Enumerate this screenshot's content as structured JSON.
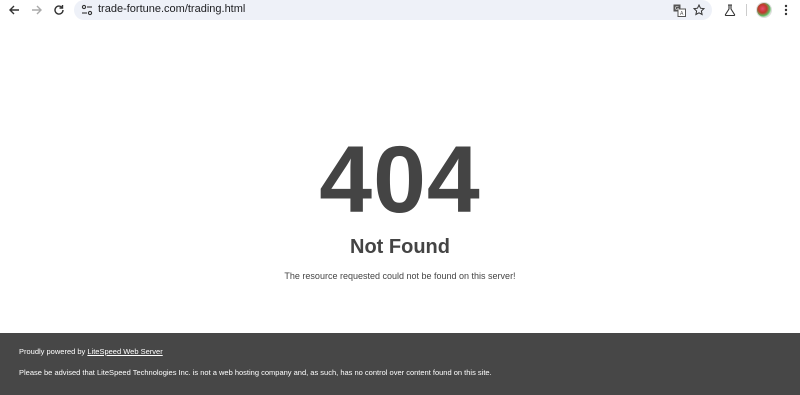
{
  "browser": {
    "url": "trade-fortune.com/trading.html",
    "icons": {
      "back": "arrow-left-icon",
      "forward": "arrow-right-icon",
      "reload": "reload-icon",
      "site_info": "site-info-icon",
      "translate": "translate-icon",
      "bookmark": "star-icon",
      "labs": "flask-icon",
      "menu": "kebab-menu-icon"
    }
  },
  "page": {
    "code": "404",
    "title": "Not Found",
    "message": "The resource requested could not be found on this server!"
  },
  "footer": {
    "powered_prefix": "Proudly powered by ",
    "powered_link": "LiteSpeed Web Server",
    "disclaimer": "Please be advised that LiteSpeed Technologies Inc. is not a web hosting company and, as such, has no control over content found on this site."
  },
  "colors": {
    "text": "#444444",
    "footer_bg": "#474747",
    "omnibox_bg": "#eef1f8"
  }
}
